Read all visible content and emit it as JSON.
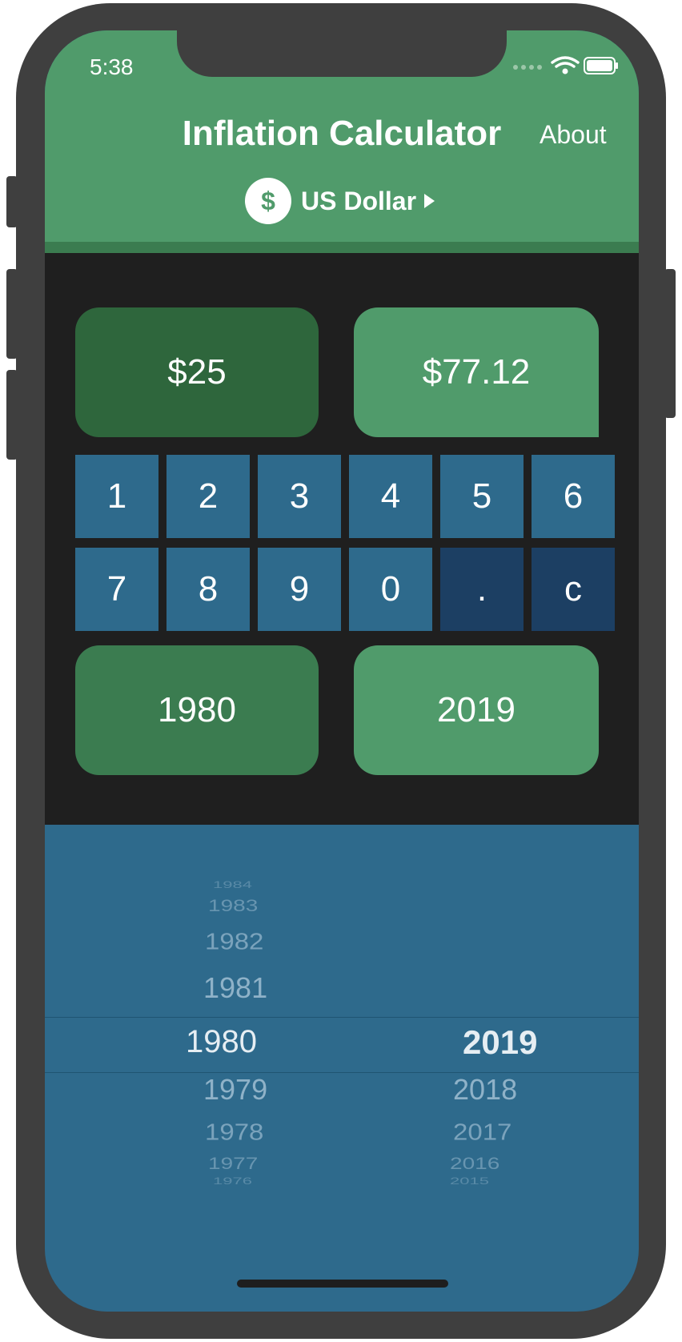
{
  "status_bar": {
    "time": "5:38"
  },
  "header": {
    "title": "Inflation Calculator",
    "about_label": "About"
  },
  "currency": {
    "symbol": "$",
    "name": "US Dollar"
  },
  "amounts": {
    "start_value": "$25",
    "result_value": "$77.12"
  },
  "keypad": {
    "keys": [
      "1",
      "2",
      "3",
      "4",
      "5",
      "6",
      "7",
      "8",
      "9",
      "0",
      ".",
      "c"
    ]
  },
  "years": {
    "start_year": "1980",
    "end_year": "2019"
  },
  "picker": {
    "left_above": [
      "1984",
      "1983",
      "1982",
      "1981"
    ],
    "left_selected": "1980",
    "left_below": [
      "1979",
      "1978",
      "1977",
      "1976"
    ],
    "right_selected": "2019",
    "right_below": [
      "2018",
      "2017",
      "2016",
      "2015"
    ]
  },
  "colors": {
    "header_green": "#509b6b",
    "start_card": "#2e663c",
    "result_card": "#509b6b",
    "start_year_card": "#3b7c50",
    "end_year_card": "#509b6b",
    "key_blue": "#2e6a8c",
    "key_dark_blue": "#1c3f63",
    "picker_background": "#2e6a8c"
  }
}
